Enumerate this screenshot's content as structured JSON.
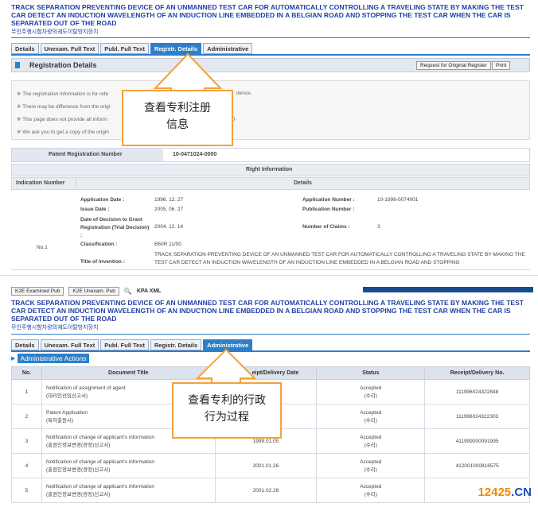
{
  "panel1": {
    "title_en": "TRACK SEPARATION PREVENTING DEVICE OF AN UNMANNED TEST CAR FOR AUTOMATICALLY CONTROLLING A TRAVELING STATE BY MAKING THE TEST CAR DETECT AN INDUCTION WAVELENGTH OF AN INDUCTION LINE EMBEDDED IN A BELGIAN ROAD AND STOPPING THE TEST CAR WHEN THE CAR IS SEPARATED OUT OF THE ROAD",
    "title_ko": "무인주행시험차량의궤도이탈방지장치",
    "tabs": [
      "Details",
      "Unexam. Full Text",
      "Publ. Full Text",
      "Registr. Details",
      "Administrative"
    ],
    "active_tab": "Registr. Details",
    "section_title": "Registration Details",
    "btn_request": "Request for Original Register",
    "btn_print": "Print",
    "notices": [
      "※ The registration information is for refe",
      "※ There may be difference from the origi",
      "※ This page does not provide all inform",
      "※ We ask you to get a copy of the origin"
    ],
    "notice_tail_1": "dence.",
    "notice_tail_3": ").",
    "patent_reg_label": "Patent Registration Number",
    "patent_reg_value": "10-0471024-0000",
    "right_info": "Right Information",
    "indication_number": "Indication Number",
    "details": "Details",
    "row_no": "No.1",
    "app_date_label": "Application Date :",
    "app_date": "1996. 12. 27",
    "issue_date_label": "Issue Date :",
    "issue_date": "2005. 06. 27",
    "decision_label": "Date of Decision to Grant Registration (Trial Decision) :",
    "decision_date": "2004. 12. 14",
    "classification_label": "Classification :",
    "classification": "B60R 11/00",
    "title_invention_label": "Title of Invention :",
    "title_invention": "TRACK SEPARATION PREVENTING DEVICE OF AN UNMANNED TEST CAR FOR AUTOMATICALLY CONTROLLING A TRAVELING STATE BY MAKING THE TEST CAR DETECT AN INDUCTION WAVELENGTH OF AN INDUCTION LINE EMBEDDED IN A BELGIAN ROAD AND STOPPING",
    "app_number_label": "Application Number :",
    "app_number": "10-1996-0074001",
    "pub_number_label": "Publication Number :",
    "claims_label": "Number of Claims :",
    "claims": "3",
    "callout": "查看专利注册信息"
  },
  "panel2": {
    "btn_k2e_exam": "K2E Examined Pub",
    "btn_k2e_unexam": "K2E Unexam. Pub",
    "kpa_xml": "KPA XML",
    "title_en": "TRACK SEPARATION PREVENTING DEVICE OF AN UNMANNED TEST CAR FOR AUTOMATICALLY CONTROLLING A TRAVELING STATE BY MAKING THE TEST CAR DETECT AN INDUCTION WAVELENGTH OF AN INDUCTION LINE EMBEDDED IN A BELGIAN ROAD AND STOPPING THE TEST CAR WHEN THE CAR IS SEPARATED OUT OF THE ROAD",
    "title_ko": "무인주행시험차량의궤도이탈방지장치",
    "tabs": [
      "Details",
      "Unexam. Full Text",
      "Publ. Full Text",
      "Registr. Details",
      "Administrative"
    ],
    "active_tab": "Administrative",
    "section_title": "Administrative Actions",
    "columns": [
      "No.",
      "Document Title",
      "eipt/Delivery Date",
      "Status",
      "Receipt/Delivery No."
    ],
    "rows": [
      {
        "no": "1",
        "title": "Notification of assignment of agent",
        "title_ko": "(대리인선임신고서)",
        "date": "",
        "status": "Accepted",
        "status_ko": "(수리)",
        "rno": "111996024322848"
      },
      {
        "no": "2",
        "title": "Patent Application",
        "title_ko": "(특허출원서)",
        "date": "",
        "status": "Accepted",
        "status_ko": "(수리)",
        "rno": "111996024322303"
      },
      {
        "no": "3",
        "title": "Notification of change of applicant's information",
        "title_ko": "(출원인정보변경(경정)신고서)",
        "date": "1999.01.05",
        "status": "Accepted",
        "status_ko": "(수리)",
        "rno": "411999000091995"
      },
      {
        "no": "4",
        "title": "Notification of change of applicant's information",
        "title_ko": "(출원인정보변경(경정)신고서)",
        "date": "2001.01.26",
        "status": "Accepted",
        "status_ko": "(수리)",
        "rno": "412001000816575"
      },
      {
        "no": "5",
        "title": "Notification of change of applicant's information",
        "title_ko": "(출원인정보변경(경정)신고서)",
        "date": "2001.02.26",
        "status": "Accepted",
        "status_ko": "(수리)",
        "rno": ""
      }
    ],
    "callout": "查看专利的行政行为过程"
  },
  "watermark_a": "12425",
  "watermark_b": ".CN",
  "colors": {
    "accent": "#2d7fc8",
    "title": "#1f3fa6",
    "callout_border": "#f2a23c",
    "watermark": "#f08a00"
  }
}
